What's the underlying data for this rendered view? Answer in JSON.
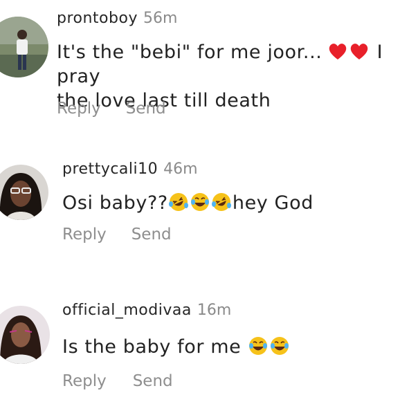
{
  "comments": [
    {
      "username": "prontoboy",
      "time": "56m",
      "text_before": "It's the \"bebi\" for me joor...",
      "emojis": [
        "heart-emoji",
        "heart-emoji"
      ],
      "text_after": " I pray",
      "text_line2": "the love last till death",
      "reply_label": "Reply",
      "send_label": "Send"
    },
    {
      "username": "prettycali10",
      "time": "46m",
      "text_before": "Osi baby??",
      "emojis": [
        "rofl-emoji",
        "joy-emoji",
        "rofl-emoji"
      ],
      "text_after": "hey God",
      "reply_label": "Reply",
      "send_label": "Send"
    },
    {
      "username": "official_modivaa",
      "time": "16m",
      "text_before": "Is the baby for me ",
      "emojis": [
        "joy-emoji",
        "joy-emoji"
      ],
      "text_after": "",
      "reply_label": "Reply",
      "send_label": "Send"
    }
  ]
}
